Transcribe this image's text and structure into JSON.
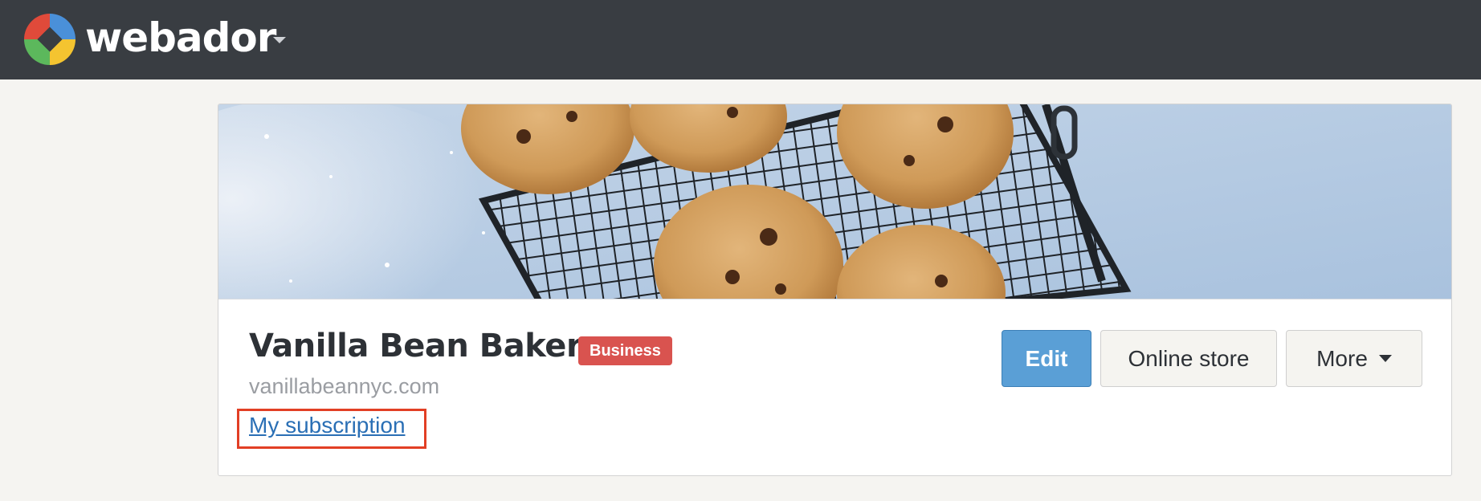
{
  "app": {
    "brand": "webador"
  },
  "site": {
    "title": "Vanilla Bean Bakery",
    "plan_badge": "Business",
    "domain": "vanillabeannyc.com",
    "subscription_link": "My subscription"
  },
  "actions": {
    "edit_label": "Edit",
    "store_label": "Online store",
    "more_label": "More"
  },
  "colors": {
    "topbar": "#393d42",
    "primary": "#5a9fd6",
    "badge": "#d9534f",
    "highlight": "#e23f25",
    "link": "#2a6fb5"
  }
}
